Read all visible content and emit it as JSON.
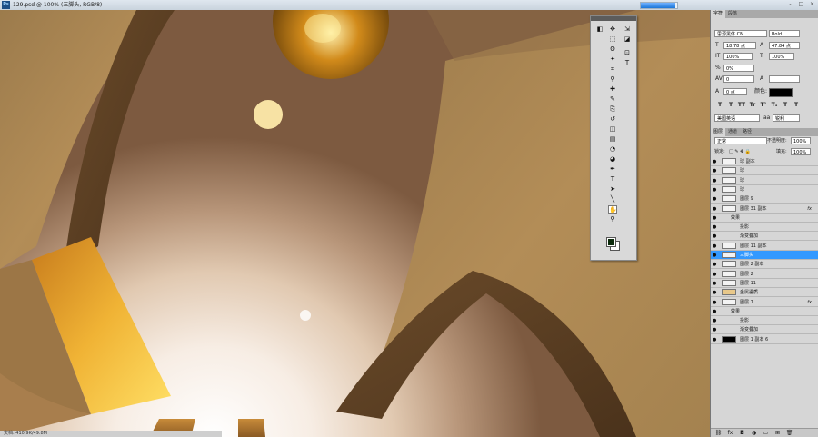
{
  "window": {
    "app_icon": "Ps",
    "doc_title": "129.psd @ 100% (三脚头, RGB/8)",
    "progress": 0.95,
    "buttons": [
      "-",
      "□",
      "×"
    ]
  },
  "toolbar": {
    "tools_left": [
      "move-icon",
      "marquee-icon",
      "lasso-icon",
      "magic-wand-icon",
      "crop-icon",
      "eyedropper-icon",
      "healing-icon",
      "brush-icon",
      "stamp-icon",
      "history-brush-icon",
      "eraser-icon",
      "gradient-icon",
      "blur-icon",
      "dodge-icon",
      "pen-icon",
      "type-icon",
      "path-select-icon",
      "line-icon",
      "hand-icon",
      "zoom-icon"
    ],
    "tool_glyphs": [
      "✥",
      "⬚",
      "ʘ",
      "✦",
      "⌗",
      "⚲",
      "✚",
      "✎",
      "⎘",
      "↺",
      "◫",
      "▤",
      "◔",
      "◕",
      "✒",
      "T",
      "➤",
      "╲",
      "✋",
      "⚲"
    ],
    "extra_glyphs": [
      "◧",
      "⇲",
      "◪",
      "⊡"
    ],
    "type_tool_label": "T",
    "fg_color": "#0b2a0b",
    "bg_color": "#ffffff"
  },
  "char_panel": {
    "tabs": [
      "字符",
      "段落"
    ],
    "font_family": "思源黑体 CN",
    "font_style": "Bold",
    "font_size": "18.78 点",
    "leading": "47.84 点",
    "vscale": "100%",
    "hscale": "100%",
    "tracking": "0%",
    "kerning": "0",
    "baseline": "0 点",
    "color_label": "颜色:",
    "language": "美国英语",
    "aa": "锐利",
    "style_buttons": [
      "T",
      "T",
      "TT",
      "Tr",
      "T¹",
      "T₁",
      "T",
      "T"
    ]
  },
  "layers_panel": {
    "tabs": [
      "图层",
      "通道",
      "路径"
    ],
    "blend_mode": "正常",
    "opacity_label": "不透明度:",
    "opacity": "100%",
    "lock_label": "锁定:",
    "fill_label": "填充:",
    "fill": "100%",
    "layers": [
      {
        "name": "球 副本",
        "kind": "normal"
      },
      {
        "name": "球",
        "kind": "normal"
      },
      {
        "name": "球",
        "kind": "normal"
      },
      {
        "name": "球",
        "kind": "normal"
      },
      {
        "name": "图层 9",
        "kind": "normal"
      },
      {
        "name": "图层 31 副本",
        "kind": "normal",
        "fx": "fx"
      },
      {
        "name": "效果",
        "kind": "effect-head"
      },
      {
        "name": "投影",
        "kind": "effect"
      },
      {
        "name": "渐变叠加",
        "kind": "effect"
      },
      {
        "name": "图层 11 副本",
        "kind": "normal"
      },
      {
        "name": "三脚头",
        "kind": "selected"
      },
      {
        "name": "图层 2 副本",
        "kind": "normal"
      },
      {
        "name": "图层 2",
        "kind": "normal"
      },
      {
        "name": "图层 11",
        "kind": "normal"
      },
      {
        "name": "金属鎏质",
        "kind": "group"
      },
      {
        "name": "图层 7",
        "kind": "normal",
        "fx": "fx"
      },
      {
        "name": "效果",
        "kind": "effect-head"
      },
      {
        "name": "投影",
        "kind": "effect"
      },
      {
        "name": "渐变叠加",
        "kind": "effect"
      },
      {
        "name": "图层 1 副本 6",
        "kind": "black"
      }
    ],
    "bottom_icons": [
      "link-icon",
      "fx-icon",
      "mask-icon",
      "adjust-icon",
      "folder-icon",
      "new-layer-icon",
      "trash-icon"
    ],
    "bottom_glyphs": [
      "⛓",
      "fx",
      "◘",
      "◑",
      "▭",
      "⊞",
      "🗑"
    ]
  },
  "status": {
    "text": "文档: 410.9K/49.8M"
  }
}
